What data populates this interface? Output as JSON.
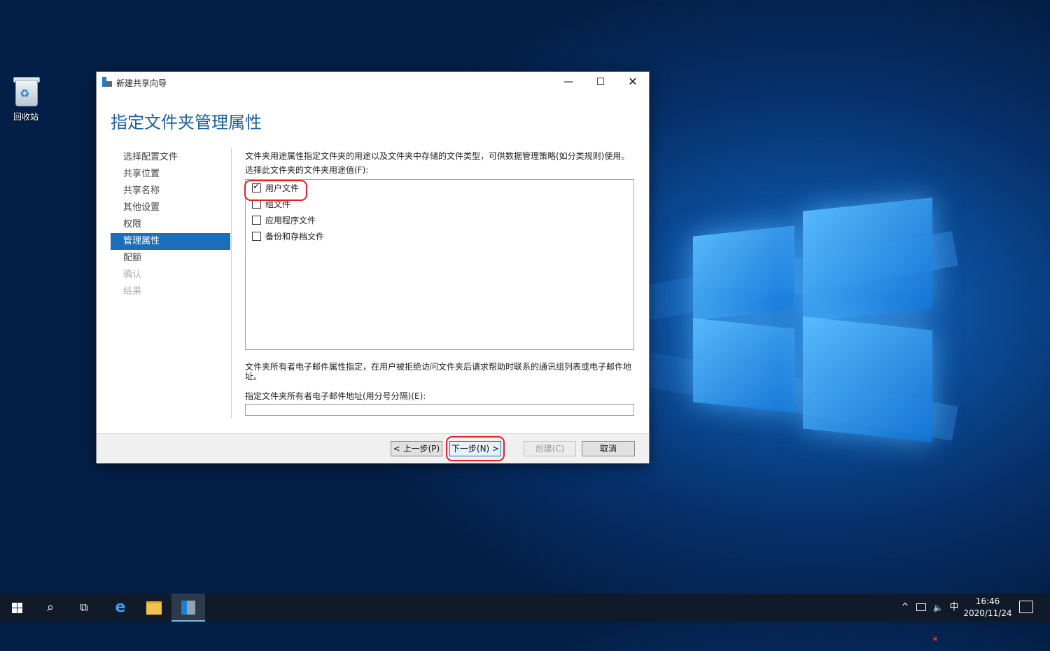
{
  "desktop": {
    "icons": [
      {
        "label": "回收站",
        "icon": "recycle-bin-icon"
      }
    ]
  },
  "window": {
    "title": "新建共享向导",
    "controls": {
      "minimize": "—",
      "maximize": "☐",
      "close": "✕"
    },
    "heading": "指定文件夹管理属性",
    "nav": [
      {
        "label": "选择配置文件",
        "state": "normal"
      },
      {
        "label": "共享位置",
        "state": "normal"
      },
      {
        "label": "共享名称",
        "state": "normal"
      },
      {
        "label": "其他设置",
        "state": "normal"
      },
      {
        "label": "权限",
        "state": "normal"
      },
      {
        "label": "管理属性",
        "state": "active"
      },
      {
        "label": "配额",
        "state": "normal"
      },
      {
        "label": "确认",
        "state": "disabled"
      },
      {
        "label": "结果",
        "state": "disabled"
      }
    ],
    "description": "文件夹用途属性指定文件夹的用途以及文件夹中存储的文件类型，可供数据管理策略(如分类规则)使用。",
    "usage_label": "选择此文件夹的文件夹用途值(F):",
    "usage_options": [
      {
        "label": "用户文件",
        "checked": true
      },
      {
        "label": "组文件",
        "checked": false
      },
      {
        "label": "应用程序文件",
        "checked": false
      },
      {
        "label": "备份和存档文件",
        "checked": false
      }
    ],
    "owner_description": "文件夹所有者电子邮件属性指定，在用户被拒绝访问文件夹后请求帮助时联系的通讯组列表或电子邮件地址。",
    "email_label": "指定文件夹所有者电子邮件地址(用分号分隔)(E):",
    "email_value": "",
    "buttons": {
      "prev": "< 上一步(P)",
      "next": "下一步(N) >",
      "create": "创建(C)",
      "cancel": "取消"
    }
  },
  "taskbar": {
    "tray": {
      "chevron": "^",
      "ime": "中"
    },
    "clock": {
      "time": "16:46",
      "date": "2020/11/24"
    }
  },
  "colors": {
    "accent": "#1a6fb8",
    "heading": "#1d5f9e",
    "highlight": "#e0202a"
  }
}
